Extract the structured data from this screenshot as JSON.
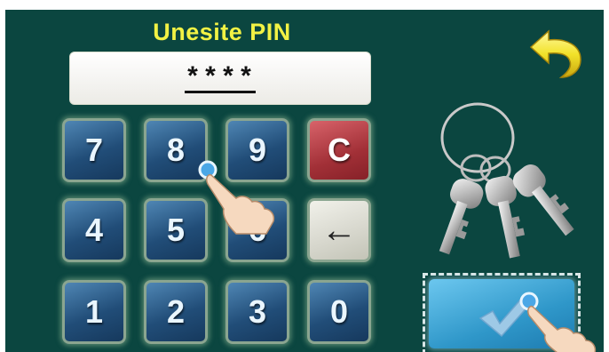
{
  "header": {
    "title": "Unesite PIN",
    "back_icon": "back-arrow-icon"
  },
  "pin_display": {
    "value": "****"
  },
  "keypad": {
    "keys": [
      "7",
      "8",
      "9",
      "C",
      "4",
      "5",
      "6",
      "←",
      "1",
      "2",
      "3",
      "0"
    ]
  },
  "confirm": {
    "icon": "checkmark-icon"
  },
  "decor": {
    "keys_icon": "keys-icon",
    "hand_icon": "pointing-hand-icon"
  },
  "colors": {
    "background": "#0b4640",
    "title": "#f2f244",
    "digit_key": "#214d78",
    "clear_key": "#a23037",
    "backspace_key": "#d6d6cc",
    "confirm_key": "#2f97c9"
  }
}
